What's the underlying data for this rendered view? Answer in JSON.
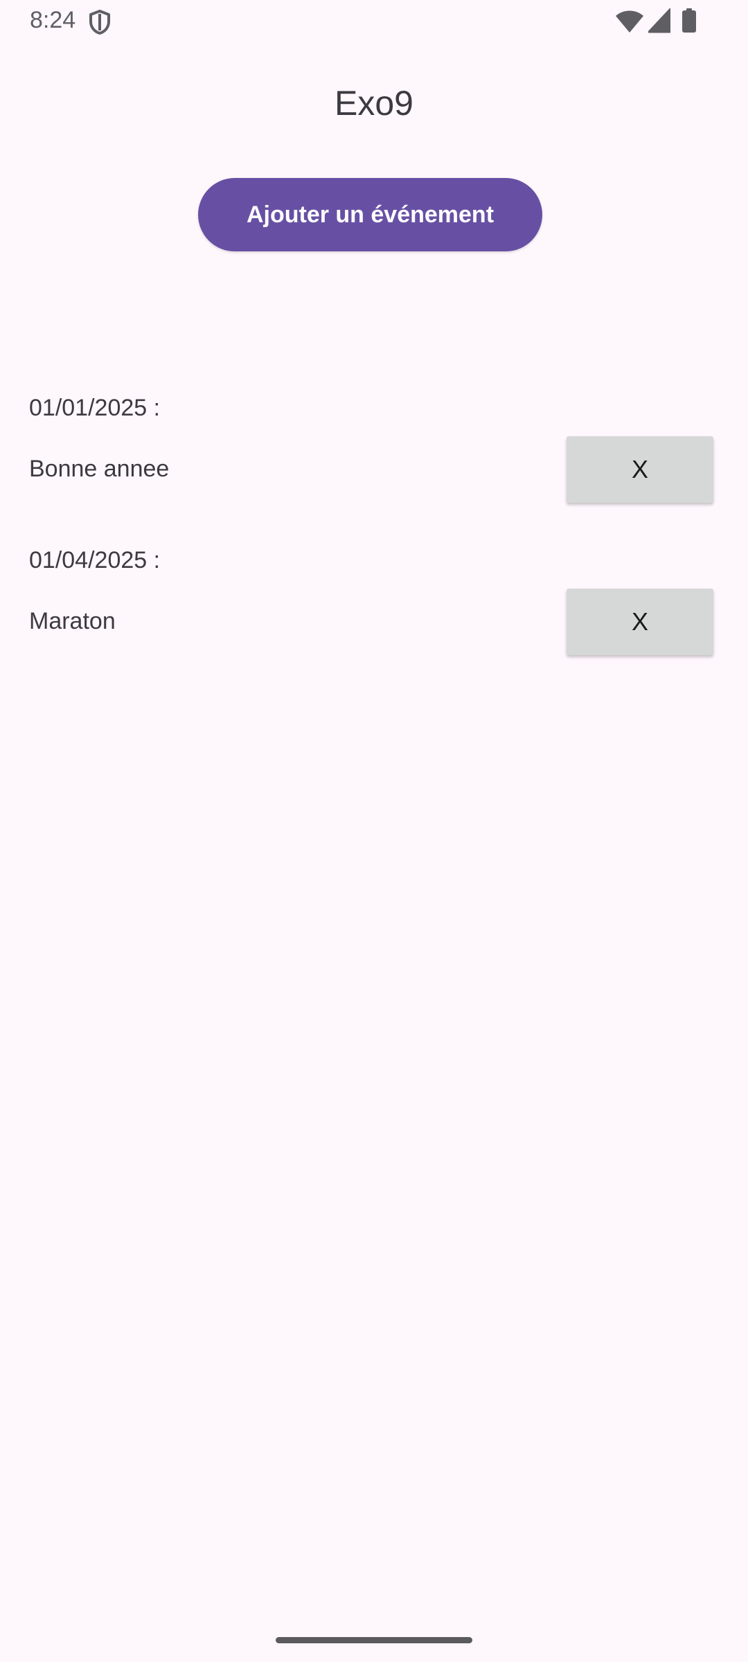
{
  "status_bar": {
    "time": "8:24"
  },
  "app": {
    "title": "Exo9"
  },
  "actions": {
    "add_event_label": "Ajouter un événement"
  },
  "events": [
    {
      "date": "01/01/2025 :",
      "name": "Bonne annee",
      "delete_label": "X"
    },
    {
      "date": "01/04/2025 :",
      "name": "Maraton",
      "delete_label": "X"
    }
  ],
  "colors": {
    "background": "#fef7fc",
    "primary": "#6750a4",
    "delete_button": "#d6d7d7",
    "text": "#3c3a40"
  }
}
